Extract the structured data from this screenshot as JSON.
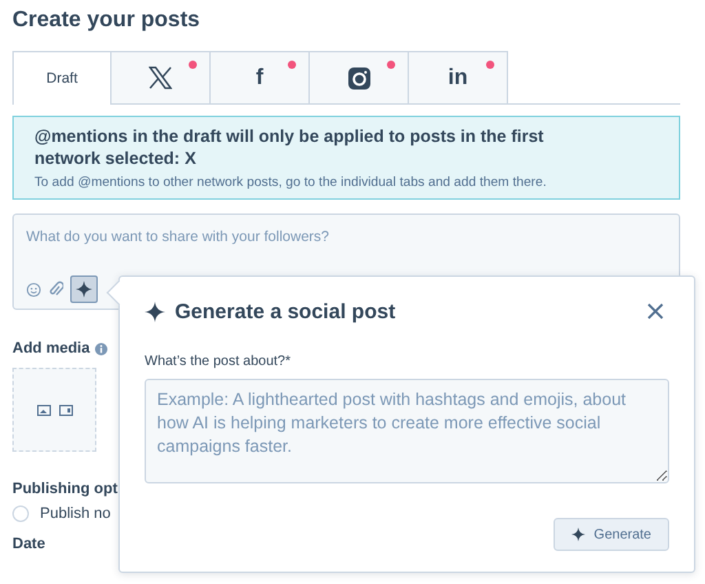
{
  "title": "Create your posts",
  "tabs": [
    {
      "kind": "text",
      "label": "Draft",
      "selected": true,
      "dot": false
    },
    {
      "kind": "x",
      "selected": false,
      "dot": true
    },
    {
      "kind": "letter",
      "label": "f",
      "selected": false,
      "dot": true
    },
    {
      "kind": "instagram",
      "selected": false,
      "dot": true
    },
    {
      "kind": "letter",
      "label": "in",
      "selected": false,
      "dot": true
    }
  ],
  "banner": {
    "heading": "@mentions in the draft will only be applied to posts in the first network selected: X",
    "text": "To add @mentions to other network posts, go to the individual tabs and add them there."
  },
  "composer": {
    "placeholder": "What do you want to share with your followers?"
  },
  "add_media": {
    "label": "Add media"
  },
  "publishing": {
    "label": "Publishing opt",
    "option": {
      "label": "Publish no",
      "selected": false
    }
  },
  "date": {
    "label": "Date"
  },
  "popover": {
    "title": "Generate a social post",
    "field_label": "What’s the post about?*",
    "placeholder": "Example: A lighthearted post with hashtags and emojis, about how AI is helping marketers to create more effective social campaigns faster.",
    "button": "Generate"
  }
}
